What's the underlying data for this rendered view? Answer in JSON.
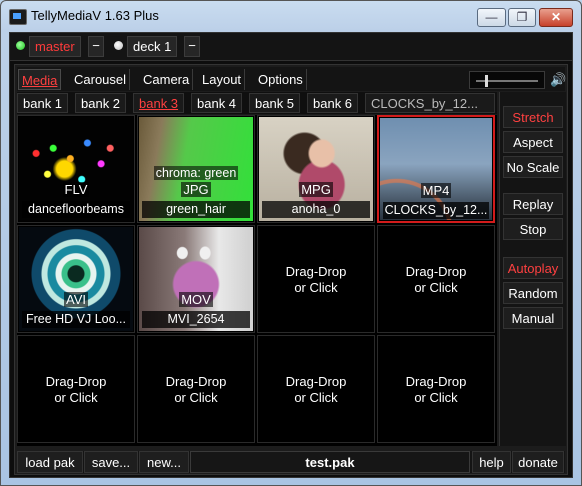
{
  "window": {
    "title": "TellyMediaV 1.63 Plus",
    "minimize": "—",
    "maximize": "❐",
    "close": "✕"
  },
  "decks": {
    "master_label": "master",
    "minus": "−",
    "deck1_label": "deck 1"
  },
  "menu": {
    "media": "Media",
    "carousel": "Carousel",
    "camera": "Camera",
    "layout": "Layout",
    "options": "Options",
    "volume_percent": 15,
    "speaker_glyph": "🔊"
  },
  "banks": [
    "bank 1",
    "bank 2",
    "bank 3",
    "bank 4",
    "bank 5",
    "bank 6",
    "CLOCKS_by_12..."
  ],
  "active_bank": "bank 3",
  "cells": [
    {
      "type": "FLV",
      "name": "dancefloorbeams"
    },
    {
      "type": "JPG",
      "name": "green_hair",
      "chroma": "chroma: green"
    },
    {
      "type": "MPG",
      "name": "anoha_0"
    },
    {
      "type": "MP4",
      "name": "CLOCKS_by_12..."
    },
    {
      "type": "AVI",
      "name": "Free HD VJ Loo..."
    },
    {
      "type": "MOV",
      "name": "MVI_2654"
    }
  ],
  "drag_drop": {
    "line1": "Drag-Drop",
    "line2": "or Click"
  },
  "side": {
    "stretch": "Stretch",
    "aspect": "Aspect",
    "no_scale": "No Scale",
    "replay": "Replay",
    "stop": "Stop",
    "autoplay": "Autoplay",
    "random": "Random",
    "manual": "Manual"
  },
  "bottom": {
    "load": "load pak",
    "save": "save...",
    "new": "new...",
    "file": "test.pak",
    "help": "help",
    "donate": "donate"
  },
  "colors": {
    "accent_red": "#ff4040",
    "selected_border": "#d21b1b",
    "led_green": "#18c418"
  }
}
